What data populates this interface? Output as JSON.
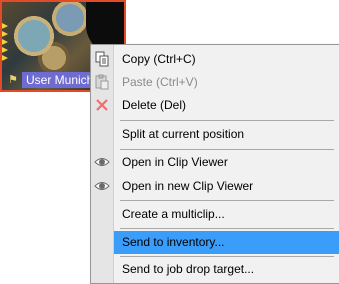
{
  "clip": {
    "label": "User Munich"
  },
  "menu": {
    "items": [
      {
        "label": "Copy (Ctrl+C)",
        "icon": "copy-icon",
        "enabled": true
      },
      {
        "label": "Paste (Ctrl+V)",
        "icon": "paste-icon",
        "enabled": false
      },
      {
        "label": "Delete (Del)",
        "icon": "delete-x-icon",
        "enabled": true
      },
      {
        "label": "Split at current position",
        "icon": "",
        "enabled": true
      },
      {
        "label": "Open in Clip Viewer",
        "icon": "eye-icon",
        "enabled": true
      },
      {
        "label": "Open in new Clip Viewer",
        "icon": "eye-icon",
        "enabled": true
      },
      {
        "label": "Create a multiclip...",
        "icon": "",
        "enabled": true
      },
      {
        "label": "Send to inventory...",
        "icon": "",
        "enabled": true,
        "highlighted": true
      },
      {
        "label": "Send to job drop target...",
        "icon": "",
        "enabled": true
      }
    ]
  },
  "colors": {
    "highlight": "#3b9dfa",
    "clip_border": "#e34a2a",
    "clip_label_bg": "#6e6cd0"
  }
}
